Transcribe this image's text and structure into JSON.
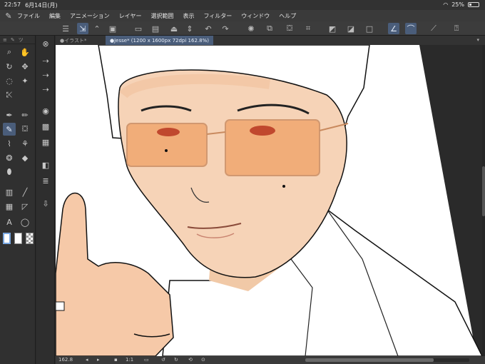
{
  "status": {
    "time": "22:57",
    "date": "6月14日(月)",
    "battery": "25%",
    "battery_level": 0.25
  },
  "menu": {
    "items": [
      "ファイル",
      "編集",
      "アニメーション",
      "レイヤー",
      "選択範囲",
      "表示",
      "フィルター",
      "ウィンドウ",
      "ヘルプ"
    ]
  },
  "tabs": {
    "inactive": "イラスト*",
    "active": "Jesse* (1200 x 1600px 72dpi 162.8%)"
  },
  "bottom": {
    "zoom": "162.8",
    "fit": "1:1"
  },
  "colors": {
    "accent": "#4a5d7a",
    "canvas_bg": "#2a2a2a",
    "ui_dark": "#303030"
  }
}
